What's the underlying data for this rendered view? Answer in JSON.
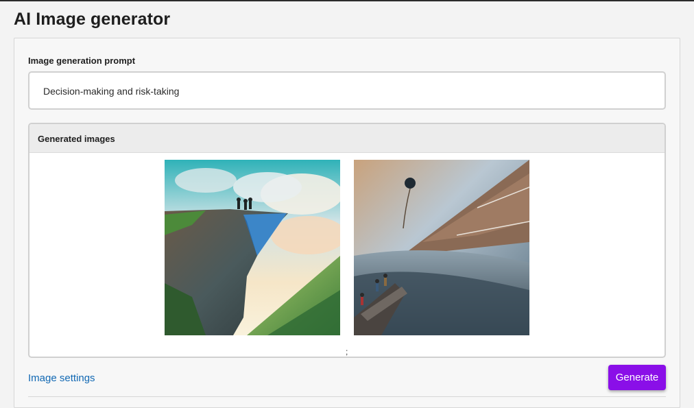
{
  "page": {
    "title": "AI Image generator"
  },
  "prompt": {
    "label": "Image generation prompt",
    "value": "Decision-making and risk-taking"
  },
  "generated": {
    "header": "Generated images",
    "images": [
      {
        "description": "painted cliff with three figures standing at edge"
      },
      {
        "description": "climbers on rocky ledge below balloon and mountains"
      }
    ],
    "separator": ";"
  },
  "footer": {
    "settings_link": "Image settings",
    "generate_label": "Generate"
  },
  "colors": {
    "accent": "#8a0fe8",
    "link": "#1168b3",
    "background": "#f3f3f3"
  }
}
